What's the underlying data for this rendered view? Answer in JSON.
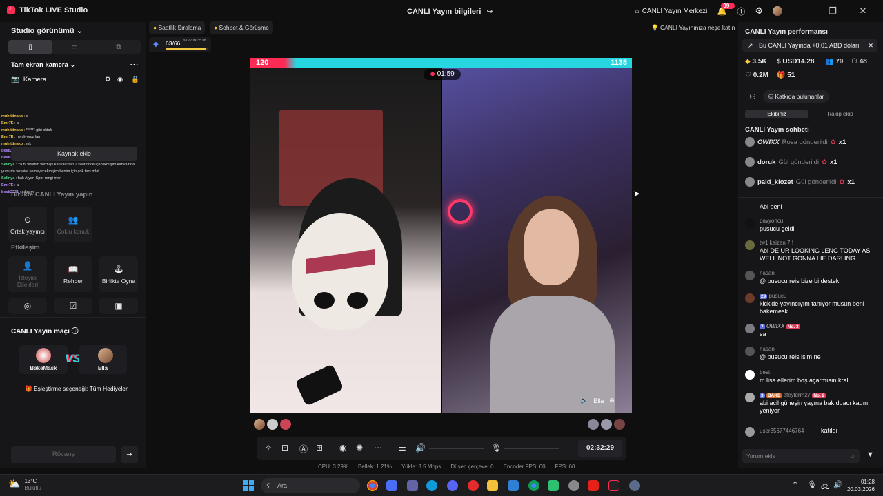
{
  "titlebar": {
    "app_name": "TikTok LIVE Studio",
    "center_title": "CANLI Yayın bilgileri",
    "live_center": "CANLI Yayın Merkezi",
    "notif_badge": "99+"
  },
  "left": {
    "view_title": "Studio görünümü",
    "source_title": "Tam ekran kamera",
    "camera_label": "Kamera",
    "add_source_tooltip": "Kaynak ekle",
    "chat_overlay": [
      {
        "name": "muhittinakb",
        "text": ": a"
      },
      {
        "name": "Emr7E",
        "text": ": a"
      },
      {
        "name": "muhittinakb",
        "text": ": ****** gibi oldak"
      },
      {
        "name": "Emr7E",
        "text": ": ne diyoruz lan"
      },
      {
        "name": "muhittinakb",
        "text": ": mk"
      },
      {
        "name": "besti2231",
        "text": ": mor yaşın"
      },
      {
        "name": "besti2231",
        "text": ": ya"
      },
      {
        "name": "Selinya",
        "text": ": Ya bi vitamin vermişti kahvaltıdan 1 saat önce içecekmişim kahvaltıda yumurta vesaire yemeyecekmişim benim için çok ters mlaf"
      },
      {
        "name": "Selinya",
        "text": ": bak Afyon Spor rengi mor"
      },
      {
        "name": "Emr7E",
        "text": ": a"
      },
      {
        "name": "besti2231",
        "text": ": çıkışım"
      }
    ],
    "together_title": "Birlikte CANLI Yayın yapın",
    "together_tiles": [
      "Ortak yayıncı",
      "Çoklu konuk"
    ],
    "interaction_title": "Etkileşim",
    "interaction_tiles": [
      "İzleyici Dilekleri",
      "Rehber",
      "Birlikte Oyna"
    ],
    "match": {
      "title": "CANLI Yayın maçı",
      "player1": "BakeMask",
      "player2": "Ella",
      "vs": "VS",
      "match_option": "Eşleştirme seçeneği: Tüm Hediyeler",
      "rematch": "Rövanş"
    }
  },
  "center": {
    "pills": [
      "Saatlik Sıralama",
      "Sohbet & Görüşme"
    ],
    "fun_pill": "CANLI Yayınınıza neşe katın",
    "progress": {
      "text": "63/66",
      "sub": "sa 27 dk 35 sn",
      "fraction": 0.95
    },
    "score_left": "120",
    "score_right": "1135",
    "battle_timer": "01:59",
    "guest_label": "Ella",
    "live_duration": "02:32:29",
    "stats": {
      "cpu": "CPU: 3.29%",
      "memory": "Bellek: 1.21%",
      "upload": "Yükle: 3.5 Mbps",
      "dropped": "Düşen çerçeve: 0",
      "encoder_fps": "Encoder FPS: 60",
      "fps": "FPS: 60"
    }
  },
  "right": {
    "perf_title": "CANLI Yayın performansı",
    "notice": "Bu CANLI Yayında +0.01 ABD doları",
    "metrics": {
      "diamonds": "3.5K",
      "earnings": "USD14.28",
      "viewers": "79",
      "new_followers": "48",
      "likes": "0.2M",
      "gifts": "51"
    },
    "contributors": "Katkıda bulunanlar",
    "tabs": [
      "Ekibiniz",
      "Rakip ekip"
    ],
    "chat_title": "CANLI Yayın sohbeti",
    "gifts": [
      {
        "user": "OWIXX",
        "action": "Rosa gönderildi",
        "count": "x1"
      },
      {
        "user": "doruk",
        "action": "Gül gönderildi",
        "count": "x1"
      },
      {
        "user": "paid_klozet",
        "action": "Gül gönderildi",
        "count": "x1"
      }
    ],
    "messages": [
      {
        "user": "",
        "text": "Abi beni"
      },
      {
        "user": "pavyoncu",
        "text": "pusucu geldii"
      },
      {
        "user": "tw1 kaizen 7 !",
        "text": "Abi DE UR LOOKING LENG TODAY AS WELL NOT GONNA LIE DARLING"
      },
      {
        "user": "hasan",
        "text": "@ pusucu  reis bize bi destek"
      },
      {
        "user": "pusucu",
        "level": "29",
        "text": "kick'de yayıncıyım tanıyor musun beni bakemesk"
      },
      {
        "user": "OWIXX",
        "level": "7",
        "badge": "No. 3",
        "text": "sa"
      },
      {
        "user": "hasan",
        "text": "@ pusucu  reis isim ne"
      },
      {
        "user": "best",
        "text": "m lisa ellerim boş açarmısın kral"
      },
      {
        "user": "efeyldrm27",
        "level": "3",
        "team": "BAKE",
        "badge": "No. 2",
        "text": "abi acil güneşin yayına bak duacı kadın yeniyor"
      },
      {
        "user": "user35677446764",
        "text": "katıldı"
      }
    ],
    "comment_placeholder": "Yorum ekle"
  },
  "taskbar": {
    "weather_temp": "13°C",
    "weather_desc": "Bulutlu",
    "search_placeholder": "Ara",
    "time": "01:28",
    "date": "20.03.2026"
  }
}
